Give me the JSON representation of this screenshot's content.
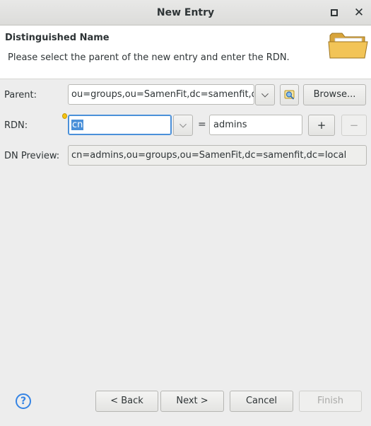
{
  "window": {
    "title": "New Entry"
  },
  "header": {
    "title": "Distinguished Name",
    "description": "Please select the parent of the new entry and enter the RDN."
  },
  "form": {
    "parent_label": "Parent:",
    "parent_value": "ou=groups,ou=SamenFit,dc=samenfit,dc=local",
    "browse_label": "Browse...",
    "rdn_label": "RDN:",
    "rdn_attribute": "cn",
    "rdn_equals": "=",
    "rdn_value": "admins",
    "add_label": "+",
    "remove_label": "−",
    "preview_label": "DN Preview:",
    "preview_value": "cn=admins,ou=groups,ou=SamenFit,dc=samenfit,dc=local"
  },
  "footer": {
    "help_label": "?",
    "back_label": "< Back",
    "next_label": "Next >",
    "cancel_label": "Cancel",
    "finish_label": "Finish"
  },
  "icons": {
    "maximize": "maximize-icon",
    "close": "close-icon",
    "folder": "folder-icon",
    "browse": "ldap-browse-icon",
    "help": "help-icon"
  },
  "colors": {
    "accent": "#4a90d9",
    "help": "#3584e4",
    "folder": "#f2c457"
  }
}
